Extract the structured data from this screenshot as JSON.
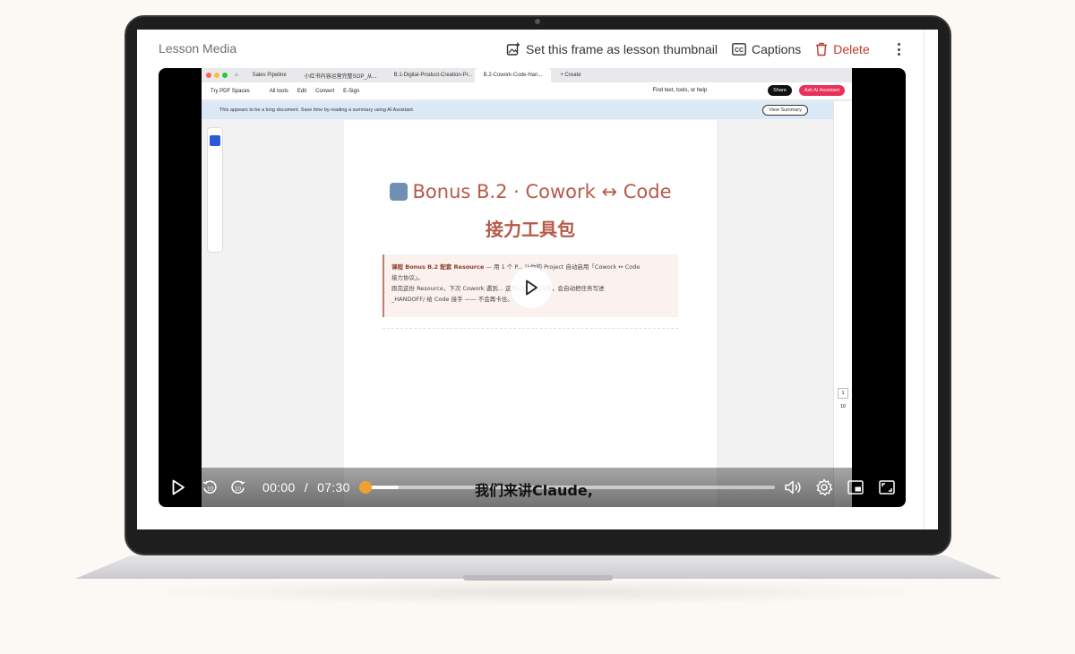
{
  "header": {
    "title": "Lesson Media",
    "thumbnail_label": "Set this frame as lesson thumbnail",
    "captions_label": "Captions",
    "delete_label": "Delete"
  },
  "colors": {
    "accent_progress": "#f0a030",
    "delete": "#c0392b",
    "doc_title": "#b55a48"
  },
  "browser": {
    "tabs": [
      "Sales Pipeline",
      "小红书内容运营完整SOP_从...",
      "B.1-Digital-Product-Creation-Pr...",
      "B.2-Cowork-Code-Han...",
      "+ Create"
    ],
    "toolbar": {
      "brand": "Try PDF Spaces",
      "items": [
        "All tools",
        "Edit",
        "Convert",
        "E-Sign"
      ],
      "search": "Find text, tools, or help",
      "share": "Share",
      "ai": "Ask AI Assistant"
    },
    "banner": "This appears to be a long document. Save time by reading a summary using AI Assistant.",
    "view_summary": "View Summary",
    "page_current": "1",
    "page_total": "10"
  },
  "document": {
    "title": "Bonus B.2 · Cowork ↔ Code",
    "subtitle": "接力工具包",
    "callout_line1_bold": "课程 Bonus B.2 配套 Resource",
    "callout_line1": " — 用 1 个 P... 让你的 Project 自动启用「Cowork ↔ Code",
    "callout_line2": "接力协议」。",
    "callout_line3": "跑完这份 Resource，下次 Cowork 遇到... 这类它做不好的事，会自动把任务写进",
    "callout_line4": "_HANDOFF/ 给 Code 接手 —— 不会再卡住。"
  },
  "video": {
    "subtitle": "我们来讲Claude,",
    "current_time": "00:00",
    "separator": "/",
    "duration": "07:30",
    "progress": 0.0,
    "buffered": 0.08
  },
  "icons": {
    "thumbnail": "image-plus-icon",
    "captions": "cc-icon",
    "delete": "trash-icon",
    "more": "kebab-icon",
    "play": "play-icon",
    "rewind": "rewind-10-icon",
    "forward": "forward-10-icon",
    "volume": "volume-icon",
    "settings": "gear-icon",
    "pip": "picture-in-picture-icon",
    "fullscreen": "fullscreen-icon"
  }
}
